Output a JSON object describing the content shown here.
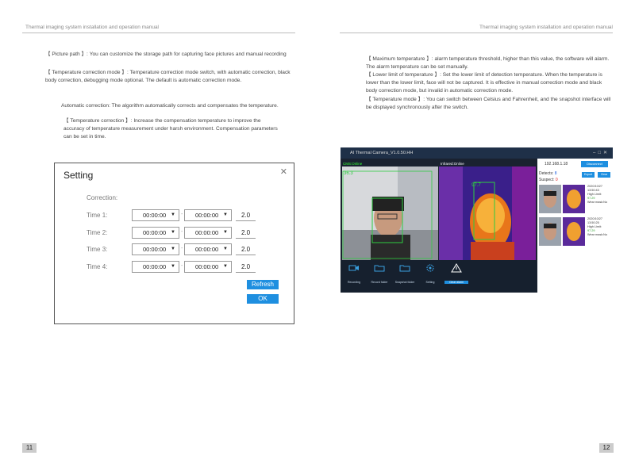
{
  "header_left": "Thermal imaging system installation and operation manual",
  "header_right": "Thermal imaging system installation and operation manual",
  "left_paragraphs": [
    "【 Picture path 】: You can customize the storage path for capturing face pictures and manual recording",
    "【 Temperature correction mode 】: Temperature correction mode switch, with automatic correction, black body correction, debugging mode optional. The default is automatic correction mode.",
    "Automatic correction: The algorithm automatically corrects and compensates the temperature.",
    "【 Temperature correction 】: Increase the compensation temperature to improve the accuracy of temperature measurement under harsh environment. Compensation parameters can be set in time."
  ],
  "right_paragraphs": [
    "【 Maximum temperature 】: alarm temperature threshold, higher than this value, the software will alarm. The alarm temperature can be set manually.",
    "【 Lower limit of temperature 】: Set the lower limit of detection temperature. When the temperature is lower than the lower limit, face will not be captured. It is effective in manual correction mode and black body correction mode, but invalid in automatic correction mode.",
    "【 Temperature mode 】: You can switch between Celsius and Fahrenheit, and the snapshot interface will be displayed synchronously after the switch."
  ],
  "dialog": {
    "title": "Setting",
    "close": "✕",
    "subtitle": "Correction:",
    "rows": [
      {
        "label": "Time 1:",
        "start": "00:00:00",
        "end": "00:00:00",
        "value": "2.0"
      },
      {
        "label": "Time 2:",
        "start": "00:00:00",
        "end": "00:00:00",
        "value": "2.0"
      },
      {
        "label": "Time 3:",
        "start": "00:00:00",
        "end": "00:00:00",
        "value": "2.0"
      },
      {
        "label": "Time 4:",
        "start": "00:00:00",
        "end": "00:00:00",
        "value": "2.0"
      }
    ],
    "dash": "-",
    "refresh_label": "Refresh",
    "ok_label": "OK"
  },
  "app": {
    "title": "AI Thermal Camera_V1.0.50.HH",
    "cms_label": "CMS:Online",
    "infrared_label": "Infrared:Online",
    "cms_temp": "36.3",
    "ir_temp": "97.7",
    "ip": "192.168.1.18",
    "disconnect_label": "Disconnect",
    "detects_label": "Detects:",
    "detects_value": "8",
    "suspect_label": "Suspect:",
    "suspect_value": "0",
    "export_label": "Export",
    "clear_label": "Clear",
    "captures": [
      {
        "date": "2020/10/27",
        "time": "13:50:43",
        "level": "High Limit:",
        "temp": "97.29",
        "mask": "Wear mask:No"
      },
      {
        "date": "2020/10/27",
        "time": "13:50:25",
        "level": "High Limit:",
        "temp": "97.29",
        "mask": "Wear mask:No"
      }
    ],
    "tools": [
      "Recording",
      "Record folder",
      "Snapshot folder",
      "Setting",
      "Clear alarm"
    ]
  },
  "page_left": "11",
  "page_right": "12"
}
